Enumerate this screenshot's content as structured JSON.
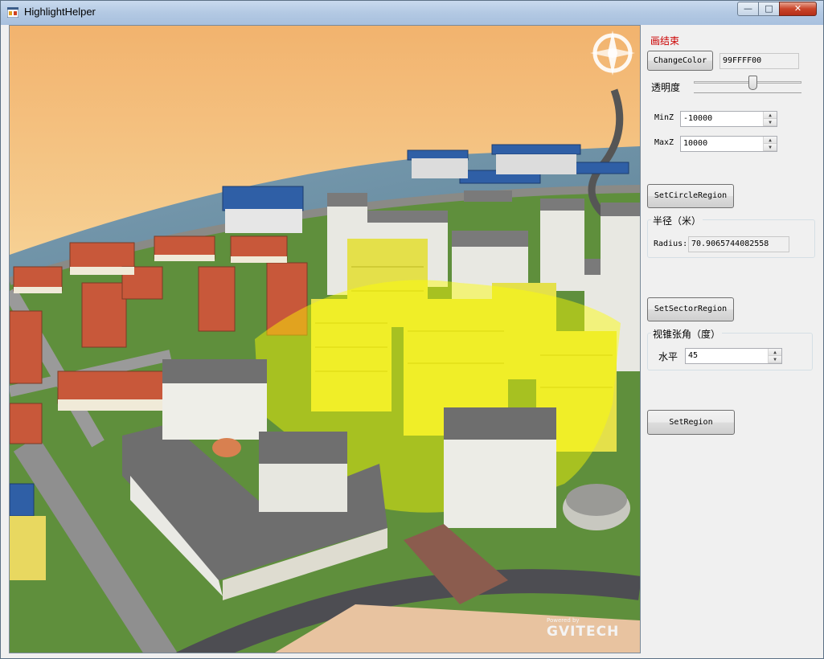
{
  "window": {
    "title": "HighlightHelper",
    "controls": {
      "minimize": "—",
      "maximize": "□",
      "close": "✕"
    }
  },
  "viewport": {
    "brand_small": "Powered by",
    "brand": "GVITECH"
  },
  "panel": {
    "status_text": "画结束",
    "change_color_button": "ChangeColor",
    "color_value": "99FFFF00",
    "opacity_label": "透明度",
    "opacity_level": 0.55,
    "minz_label": "MinZ",
    "minz_value": "-10000",
    "maxz_label": "MaxZ",
    "maxz_value": "10000",
    "set_circle_button": "SetCircleRegion",
    "radius_group_title": "半径（米）",
    "radius_label": "Radius:",
    "radius_value": "70.9065744082558",
    "set_sector_button": "SetSectorRegion",
    "angle_group_title": "视锥张角（度）",
    "horizontal_label": "水平",
    "horizontal_value": "45",
    "set_region_button": "SetRegion"
  },
  "colors": {
    "status": "#cc0000",
    "highlight": "#ffff00"
  }
}
